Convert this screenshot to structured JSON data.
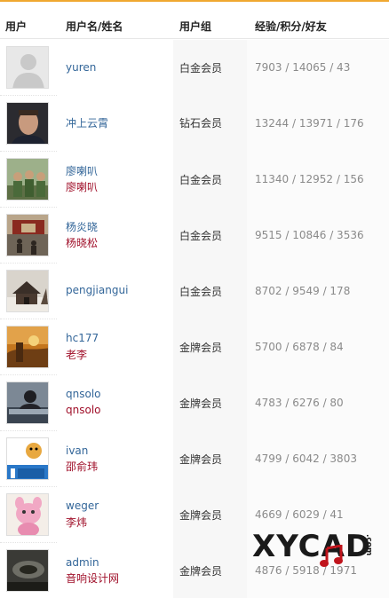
{
  "header": {
    "user": "用户",
    "name": "用户名/姓名",
    "group": "用户组",
    "stats": "经验/积分/好友"
  },
  "rows": [
    {
      "avatar": "default-silhouette-avatar",
      "username": "yuren",
      "realname": "",
      "group": "白金会员",
      "stats": "7903 / 14065 / 43"
    },
    {
      "avatar": "man-portrait-avatar",
      "username": "冲上云霄",
      "realname": "",
      "group": "钻石会员",
      "stats": "13244 / 13971 / 176"
    },
    {
      "avatar": "soldiers-photo-avatar",
      "username": "廖喇叭",
      "realname": "廖喇叭",
      "group": "白金会员",
      "stats": "11340 / 12952 / 156"
    },
    {
      "avatar": "square-crowd-avatar",
      "username": "杨炎晓",
      "realname": "杨晓松",
      "group": "白金会员",
      "stats": "9515 / 10846 / 3536"
    },
    {
      "avatar": "snowy-house-avatar",
      "username": "pengjiangui",
      "realname": "",
      "group": "白金会员",
      "stats": "8702 / 9549 / 178"
    },
    {
      "avatar": "sunset-landscape-avatar",
      "username": "hc177",
      "realname": "老李",
      "group": "金牌会员",
      "stats": "5700 / 6878 / 84"
    },
    {
      "avatar": "studio-person-avatar",
      "username": "qnsolo",
      "realname": "qnsolo",
      "group": "金牌会员",
      "stats": "4783 / 6276 / 80"
    },
    {
      "avatar": "ivan-cartoon-avatar",
      "username": "ivan",
      "realname": "邵俞玮",
      "group": "金牌会员",
      "stats": "4799 / 6042 / 3803"
    },
    {
      "avatar": "pink-cartoon-avatar",
      "username": "weger",
      "realname": "李炜",
      "group": "金牌会员",
      "stats": "4669 / 6029 / 41"
    },
    {
      "avatar": "dark-speaker-avatar",
      "username": "admin",
      "realname": "音响设计网",
      "group": "金牌会员",
      "stats": "4876 / 5918 / 1971"
    }
  ],
  "watermark": {
    "text": "XYCAD",
    "suffix": ".com"
  },
  "colors": {
    "accent_line": "#f0a830",
    "username": "#336699",
    "realname": "#a0102a",
    "stats": "#8a8a8a"
  }
}
